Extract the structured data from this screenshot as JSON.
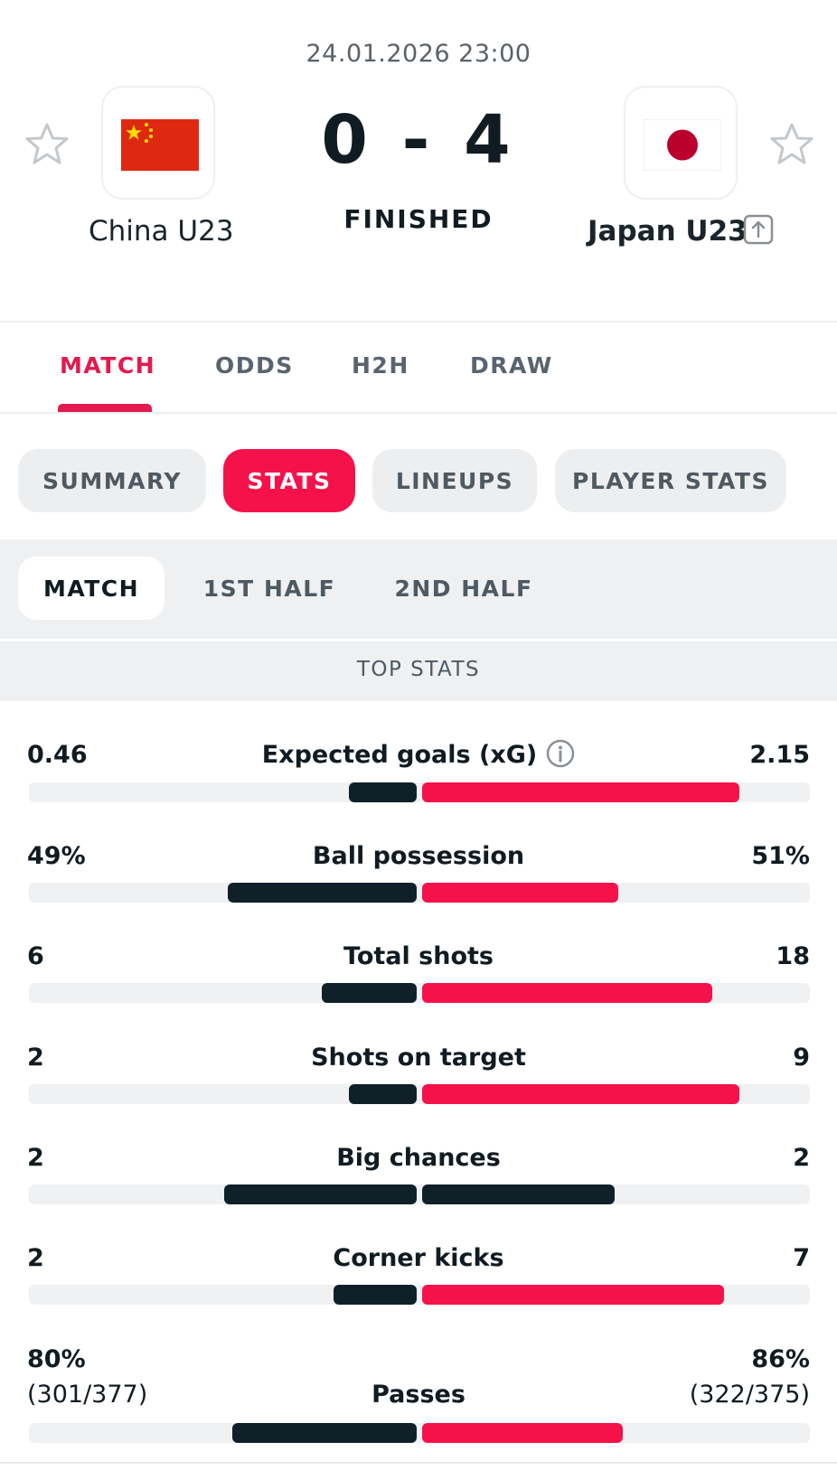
{
  "match": {
    "datetime": "24.01.2026 23:00",
    "score": "0 - 4",
    "status": "FINISHED",
    "home_team": "China U23",
    "away_team": "Japan U23",
    "home_flag": "china-flag-icon",
    "away_flag": "japan-flag-icon"
  },
  "main_tabs": [
    {
      "label": "MATCH",
      "active": true
    },
    {
      "label": "ODDS",
      "active": false
    },
    {
      "label": "H2H",
      "active": false
    },
    {
      "label": "DRAW",
      "active": false
    }
  ],
  "sub_tabs": [
    {
      "label": "SUMMARY",
      "active": false
    },
    {
      "label": "STATS",
      "active": true
    },
    {
      "label": "LINEUPS",
      "active": false
    },
    {
      "label": "PLAYER STATS",
      "active": false
    }
  ],
  "periods": [
    {
      "label": "MATCH",
      "active": true
    },
    {
      "label": "1ST HALF",
      "active": false
    },
    {
      "label": "2ND HALF",
      "active": false
    }
  ],
  "section_title": "TOP STATS",
  "stats": [
    {
      "label": "Expected goals (xG)",
      "home": "0.46",
      "away": "2.15",
      "home_share": 0.18,
      "away_share": 0.82,
      "info_icon": true
    },
    {
      "label": "Ball possession",
      "home": "49%",
      "away": "51%",
      "home_share": 0.49,
      "away_share": 0.51
    },
    {
      "label": "Total shots",
      "home": "6",
      "away": "18",
      "home_share": 0.25,
      "away_share": 0.75
    },
    {
      "label": "Shots on target",
      "home": "2",
      "away": "9",
      "home_share": 0.18,
      "away_share": 0.82
    },
    {
      "label": "Big chances",
      "home": "2",
      "away": "2",
      "home_share": 0.5,
      "away_share": 0.5
    },
    {
      "label": "Corner kicks",
      "home": "2",
      "away": "7",
      "home_share": 0.22,
      "away_share": 0.78
    },
    {
      "label": "Passes",
      "home": "80%",
      "home_detail": "(301/377)",
      "away": "86%",
      "away_detail": "(322/375)",
      "home_share": 0.48,
      "away_share": 0.52
    }
  ],
  "colors": {
    "accent": "#f5124b",
    "home_bar": "#0f2029",
    "away_bar": "#f5124b",
    "away_bar_equal": "#0f2029"
  }
}
